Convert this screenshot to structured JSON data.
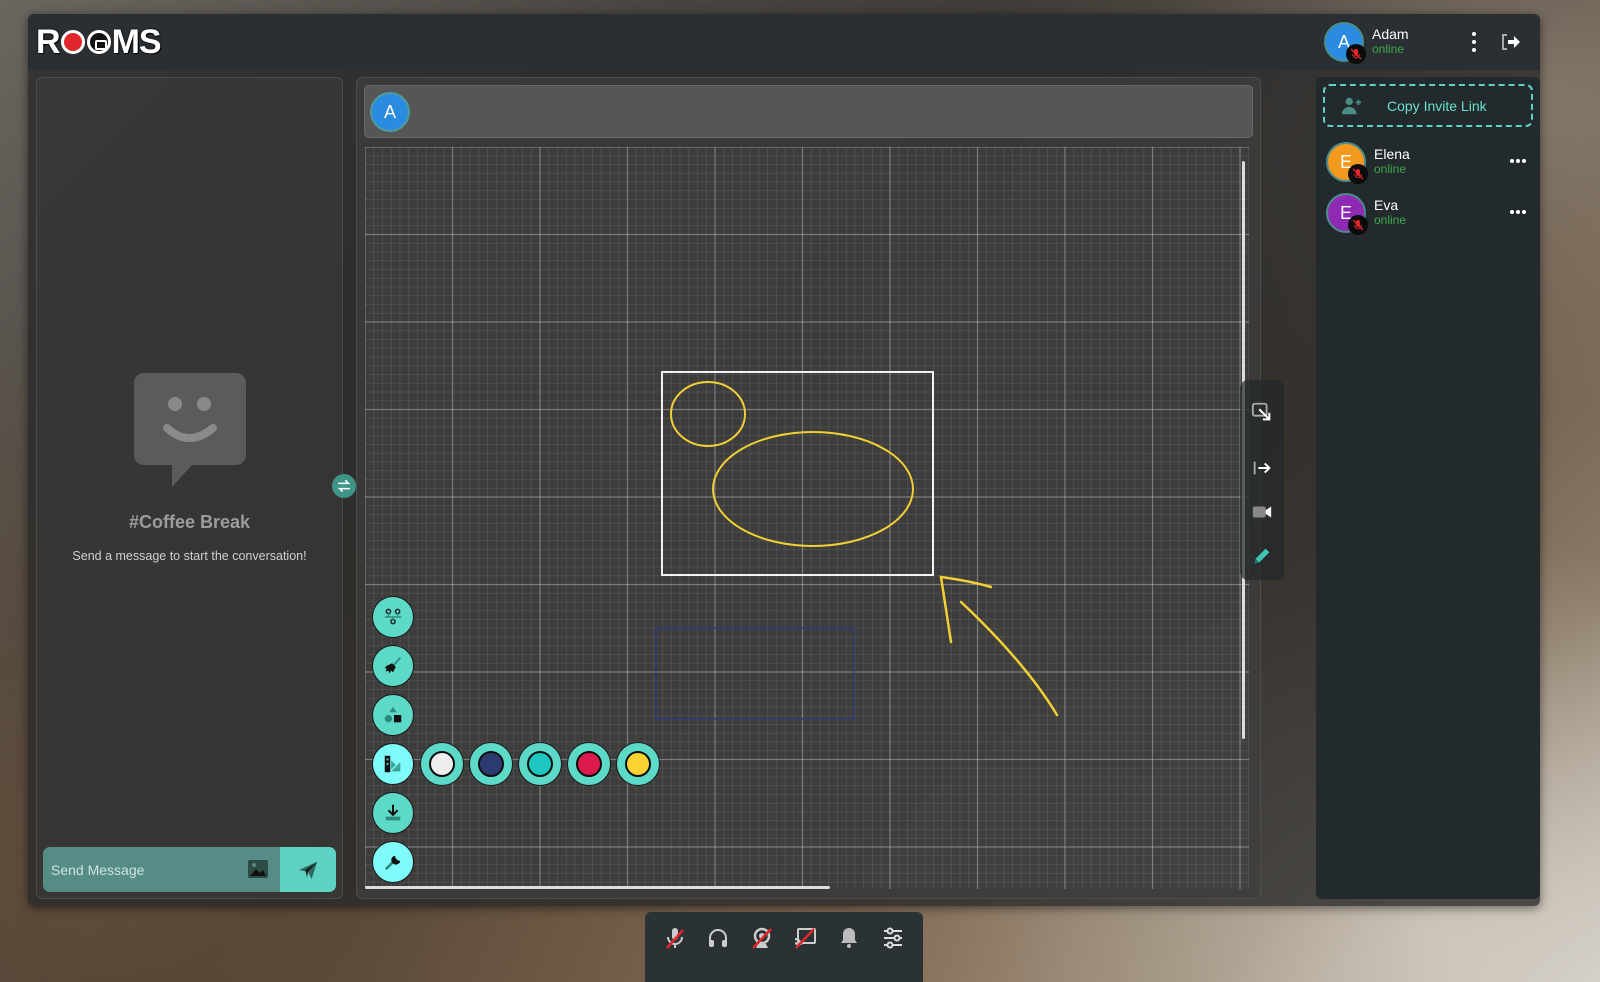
{
  "app": {
    "logo_text": "ROOMS"
  },
  "current_user": {
    "initial": "A",
    "name": "Adam",
    "status": "online",
    "avatar_color": "#2b8be0"
  },
  "chat": {
    "channel_title": "#Coffee Break",
    "empty_message": "Send a message to start the conversation!",
    "input_placeholder": "Send Message"
  },
  "board": {
    "participants": [
      {
        "initial": "A",
        "color": "#2b8be0"
      }
    ],
    "palette": [
      {
        "name": "white",
        "color": "#eeeeee"
      },
      {
        "name": "navy",
        "color": "#2c3a70"
      },
      {
        "name": "teal",
        "color": "#1ec7c0"
      },
      {
        "name": "crimson",
        "color": "#dc1a4d"
      },
      {
        "name": "yellow",
        "color": "#fad232"
      }
    ],
    "tools": [
      "connector-tool",
      "clear-brush-tool",
      "shapes-tool",
      "color-palette-tool",
      "download-tool",
      "settings-wrench-tool"
    ],
    "shapes": {
      "stroke_yellow": "#f0d033",
      "stroke_white": "#f2f2f2",
      "stroke_navy": "#2e3c78"
    }
  },
  "members": {
    "invite_label": "Copy Invite Link",
    "list": [
      {
        "initial": "E",
        "name": "Elena",
        "status": "online",
        "color": "#f39a1e"
      },
      {
        "initial": "E",
        "name": "Eva",
        "status": "online",
        "color": "#8e2ab3"
      }
    ]
  },
  "dock": {
    "items": [
      "microphone-muted",
      "headphones",
      "camera-muted",
      "screen-share-off",
      "notifications",
      "settings-sliders"
    ]
  },
  "colors": {
    "accent": "#5fd3c3",
    "status_online": "#3ea84a",
    "mute_red": "#e0262b"
  }
}
